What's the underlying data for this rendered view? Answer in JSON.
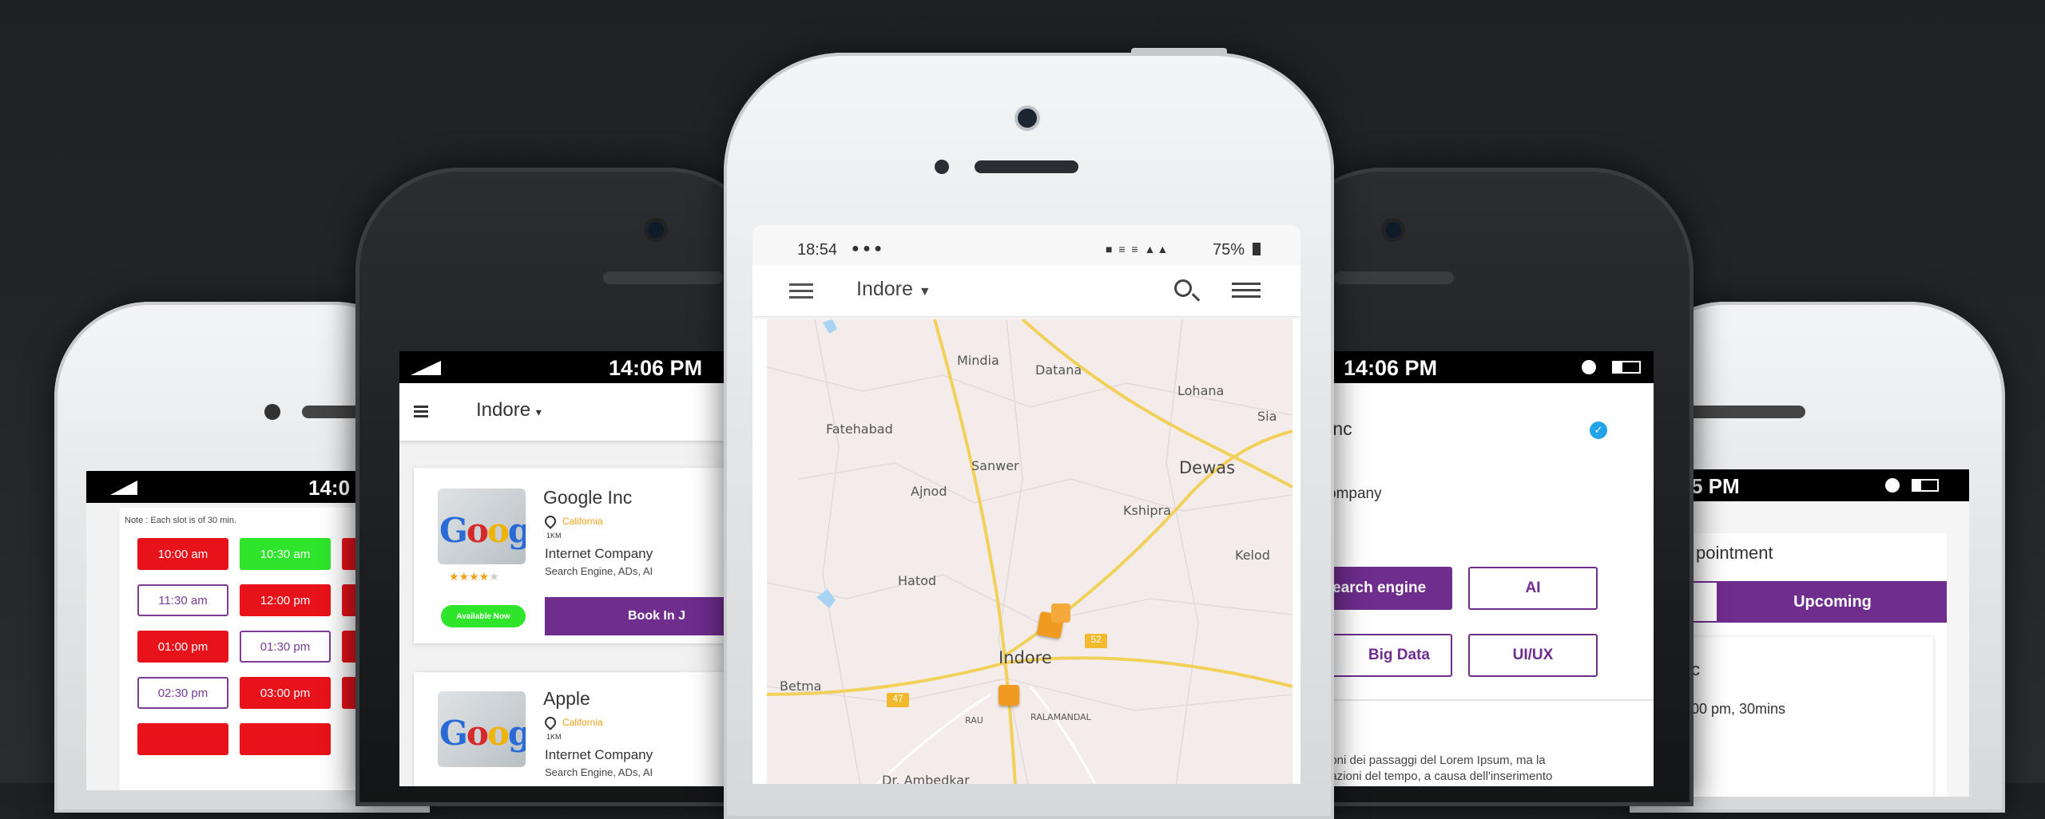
{
  "phone1": {
    "status_time": "14:0",
    "note": "Note : Each slot is of 30 min.",
    "slots": [
      "10:00 am",
      "10:30 am",
      "11:30 am",
      "12:00 pm",
      "01:00 pm",
      "01:30 pm",
      "02:30 pm",
      "03:00 pm"
    ]
  },
  "phone2": {
    "status_time": "14:06 PM",
    "city": "Indore",
    "companies": [
      {
        "name": "Google Inc",
        "location": "California",
        "distance": "1KM",
        "category": "Internet Company",
        "tags": "Search Engine, ADs, AI",
        "availability": "Available Now",
        "book_label": "Book In J"
      },
      {
        "name": "Apple",
        "location": "California",
        "distance": "1KM",
        "category": "Internet Company",
        "tags": "Search Engine, ADs, AI"
      }
    ],
    "logo_text": "Googl"
  },
  "phone3": {
    "status_time": "18:54",
    "status_right": "75%",
    "city": "Indore",
    "map_labels": [
      "Mindia",
      "Datana",
      "Lohana",
      "Sia",
      "Fatehabad",
      "Sanwer",
      "Dewas",
      "Ajnod",
      "Kshipra",
      "Kelod",
      "Hatod",
      "Indore",
      "Betma",
      "RAU",
      "RALAMANDAL",
      "Dr. Ambedkar"
    ],
    "road_shields": [
      "52",
      "47"
    ]
  },
  "phone4": {
    "status_time": "14:06 PM",
    "title": "Inc",
    "subtitle": "ompany",
    "chips": [
      "earch engine",
      "AI",
      "Big Data",
      "UI/UX"
    ],
    "text_line1": "ioni dei passaggi del Lorem Ipsum, ma la",
    "text_line2": "iazioni del tempo, a causa dell'inserimento"
  },
  "phone5": {
    "status_time": "5 PM",
    "header": "pointment",
    "tab_upcoming": "Upcoming",
    "card_title": "c",
    "card_detail": "00 pm, 30mins"
  },
  "colors": {
    "purple": "#6f2d8e",
    "red": "#e8121a",
    "green": "#2ee52b",
    "orange": "#f0a118",
    "map_bg": "#f3ecea"
  }
}
